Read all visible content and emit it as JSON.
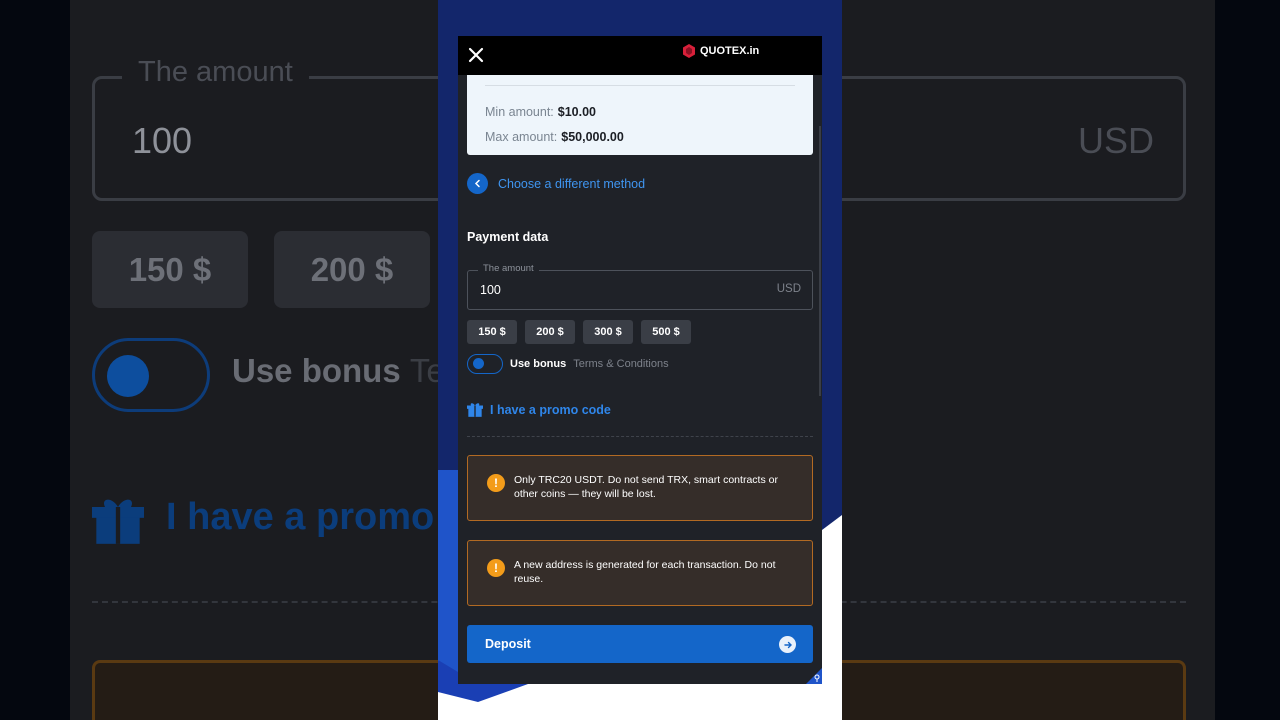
{
  "background": {
    "amount_legend": "The amount",
    "amount_value": "100",
    "amount_currency": "USD",
    "chips": [
      "150 $",
      "200 $"
    ],
    "bonus_label": "Use bonus",
    "terms_fragment": "Te",
    "promo_fragment": "I have a promo"
  },
  "header": {
    "brand": "QUOTEX.in",
    "close_icon": "close-icon"
  },
  "limits": {
    "min_label": "Min amount:",
    "min_value": "$10.00",
    "max_label": "Max amount:",
    "max_value": "$50,000.00"
  },
  "back_link": "Choose a different method",
  "payment": {
    "title": "Payment data",
    "amount_label": "The amount",
    "amount_value": "100",
    "currency": "USD",
    "quick_amounts": [
      "150 $",
      "200 $",
      "300 $",
      "500 $"
    ]
  },
  "bonus": {
    "label": "Use bonus",
    "terms": "Terms & Conditions",
    "enabled": true
  },
  "promo": {
    "label": "I have a promo code",
    "icon": "gift-icon"
  },
  "warnings": [
    "Only TRC20 USDT. Do not send TRX, smart contracts or other coins — they will be lost.",
    "A new address is generated for each transaction. Do not reuse."
  ],
  "deposit": {
    "label": "Deposit",
    "icon": "arrow-right-circle-icon"
  },
  "colors": {
    "accent": "#1466c9",
    "link": "#3f95f0",
    "warning": "#f39c1a",
    "warning_border": "#b26a23",
    "panel": "#1f2228",
    "page_top": "#13266b"
  }
}
